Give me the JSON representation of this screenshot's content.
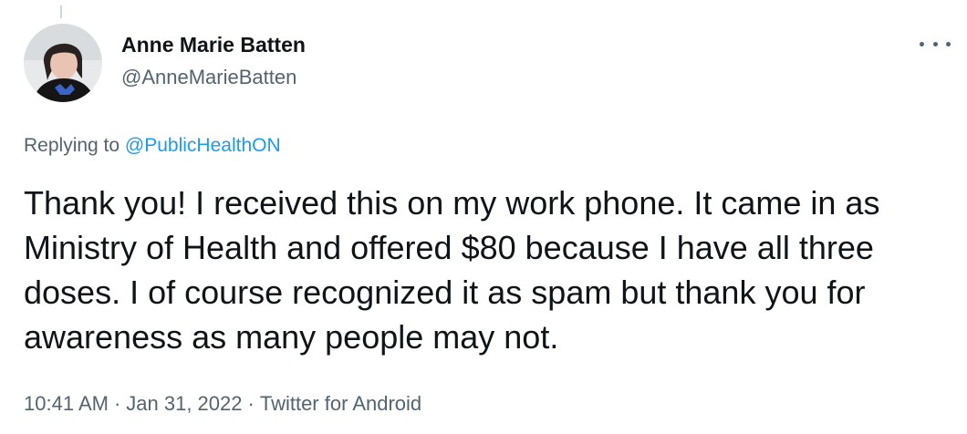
{
  "author": {
    "display_name": "Anne Marie Batten",
    "handle": "@AnneMarieBatten",
    "avatar_icon": "profile-photo"
  },
  "reply": {
    "prefix": "Replying to",
    "mention": "@PublicHealthON"
  },
  "tweet": {
    "text": "Thank you! I received this on my work phone. It came in as Ministry of Health and offered $80 because I have all three doses. I of course recognized it as spam but thank you for awareness as many people may not."
  },
  "meta": {
    "time": "10:41 AM",
    "separator": "·",
    "date": "Jan 31, 2022",
    "source": "Twitter for Android"
  },
  "colors": {
    "accent": "#1d9bf0",
    "secondary_text": "#536471",
    "primary_text": "#0f1419"
  }
}
